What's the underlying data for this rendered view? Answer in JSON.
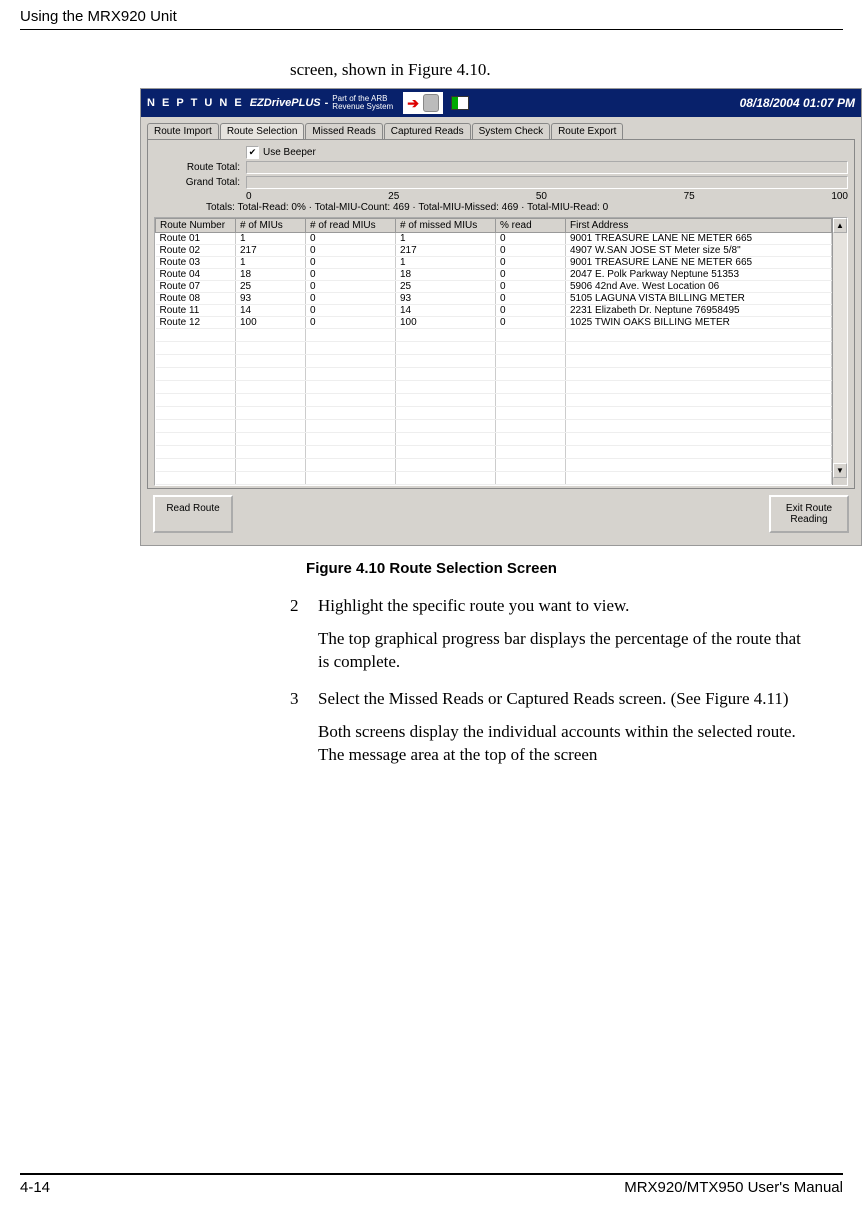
{
  "header": {
    "section_title": "Using the MRX920 Unit"
  },
  "intro": {
    "text": "screen, shown in Figure 4.10."
  },
  "app": {
    "brand": "N E P T U N E",
    "product": "EZDrivePLUS",
    "tagline1": "Part of the ARB",
    "tagline2": "Revenue System",
    "datetime": "08/18/2004 01:07 PM",
    "tabs": [
      "Route Import",
      "Route Selection",
      "Missed Reads",
      "Captured Reads",
      "System Check",
      "Route Export"
    ],
    "active_tab_index": 1,
    "use_beeper_label": "Use Beeper",
    "route_total_label": "Route Total:",
    "grand_total_label": "Grand Total:",
    "scale": [
      "0",
      "25",
      "50",
      "75",
      "100"
    ],
    "totals_label": "Totals:",
    "totals_text": "Total-Read: 0%  ·  Total-MIU-Count: 469  ·  Total-MIU-Missed: 469  ·  Total-MIU-Read: 0",
    "columns": [
      "Route Number",
      "# of MIUs",
      "# of read MIUs",
      "# of missed MIUs",
      "% read",
      "First Address"
    ],
    "rows": [
      {
        "route": "Route 01",
        "mius": "1",
        "read": "0",
        "missed": "1",
        "pct": "0",
        "addr": "9001 TREASURE LANE NE   METER 665"
      },
      {
        "route": "Route 02",
        "mius": "217",
        "read": "0",
        "missed": "217",
        "pct": "0",
        "addr": "4907 W.SAN JOSE ST     Meter size  5/8\""
      },
      {
        "route": "Route 03",
        "mius": "1",
        "read": "0",
        "missed": "1",
        "pct": "0",
        "addr": "9001 TREASURE LANE NE   METER 665"
      },
      {
        "route": "Route 04",
        "mius": "18",
        "read": "0",
        "missed": "18",
        "pct": "0",
        "addr": "2047 E. Polk Parkway    Neptune 51353"
      },
      {
        "route": "Route 07",
        "mius": "25",
        "read": "0",
        "missed": "25",
        "pct": "0",
        "addr": "5906 42nd Ave. West     Location 06"
      },
      {
        "route": "Route 08",
        "mius": "93",
        "read": "0",
        "missed": "93",
        "pct": "0",
        "addr": "5105 LAGUNA VISTA       BILLING METER"
      },
      {
        "route": "Route 11",
        "mius": "14",
        "read": "0",
        "missed": "14",
        "pct": "0",
        "addr": "2231 Elizabeth Dr.      Neptune 76958495"
      },
      {
        "route": "Route 12",
        "mius": "100",
        "read": "0",
        "missed": "100",
        "pct": "0",
        "addr": "1025 TWIN OAKS          BILLING METER"
      }
    ],
    "read_route_btn": "Read Route",
    "exit_btn_line1": "Exit Route",
    "exit_btn_line2": "Reading"
  },
  "figure_caption": "Figure 4.10   Route Selection Screen",
  "steps": {
    "s2_num": "2",
    "s2_text": "Highlight the specific route you want to view.",
    "s2_sub": "The top graphical progress bar displays the percentage of the route that is complete.",
    "s3_num": "3",
    "s3_text": "Select the Missed Reads or Captured Reads screen. (See Figure 4.11)",
    "s3_sub": "Both screens display the individual accounts within the selected route. The message area at the top of the screen"
  },
  "footer": {
    "left": "4-14",
    "right": "MRX920/MTX950 User's Manual"
  }
}
